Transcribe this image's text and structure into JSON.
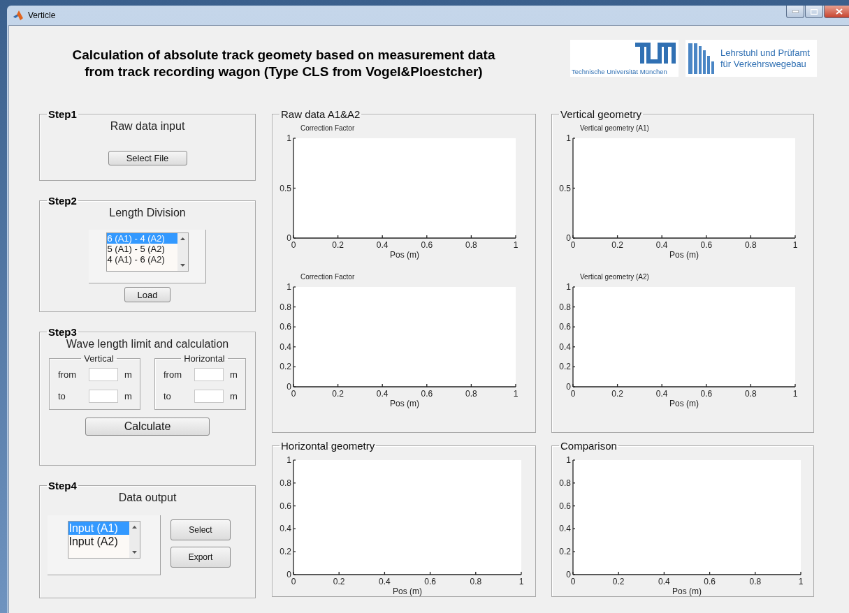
{
  "window": {
    "title": "Verticle"
  },
  "header": {
    "title_lines": [
      "Calculation of absolute track geomety based on measurement data",
      "from track recording wagon (Type CLS from Vogel&Ploestcher)"
    ],
    "logos": [
      {
        "kind": "tum",
        "lines": [
          "Technische Universität München"
        ]
      },
      {
        "kind": "chair",
        "lines": [
          "Lehrstuhl und Prüfamt",
          "für Verkehrswegebau"
        ]
      }
    ]
  },
  "steps": [
    {
      "legend": "Step1",
      "kind": "file",
      "heading": "Raw data input",
      "buttons": [
        "Select File"
      ]
    },
    {
      "legend": "Step2",
      "kind": "list",
      "heading": "Length Division",
      "options": [
        {
          "label": "6 (A1) - 4 (A2)",
          "selected": true
        },
        {
          "label": "5 (A1) - 5 (A2)",
          "selected": false
        },
        {
          "label": "4 (A1) - 6 (A2)",
          "selected": false
        }
      ],
      "buttons": [
        "Load"
      ]
    },
    {
      "legend": "Step3",
      "kind": "range",
      "heading": "Wave length limit and calculation",
      "groups": [
        {
          "title": "Vertical",
          "rows": [
            {
              "label": "from",
              "unit": "m"
            },
            {
              "label": "to",
              "unit": "m"
            }
          ]
        },
        {
          "title": "Horizontal",
          "rows": [
            {
              "label": "from",
              "unit": "m"
            },
            {
              "label": "to",
              "unit": "m"
            }
          ]
        }
      ],
      "buttons": [
        "Calculate"
      ]
    },
    {
      "legend": "Step4",
      "kind": "output",
      "heading": "Data output",
      "options": [
        {
          "label": "Input (A1)",
          "selected": true
        },
        {
          "label": "Input (A2)",
          "selected": false
        }
      ],
      "buttons": [
        "Select",
        "Export"
      ]
    }
  ],
  "plot_panels": [
    {
      "title": "Raw data A1&A2",
      "charts": [
        {
          "chart_data": {
            "type": "line",
            "title": "Correction Factor",
            "xlabel": "Pos (m)",
            "xlim": [
              0,
              1
            ],
            "ylim": [
              0,
              1
            ],
            "xticks": [
              0,
              0.2,
              0.4,
              0.6,
              0.8,
              1
            ],
            "yticks": [
              0,
              0.5,
              1
            ]
          }
        },
        {
          "chart_data": {
            "type": "line",
            "title": "Correction Factor",
            "xlabel": "Pos (m)",
            "xlim": [
              0,
              1
            ],
            "ylim": [
              0,
              1
            ],
            "xticks": [
              0,
              0.2,
              0.4,
              0.6,
              0.8,
              1
            ],
            "yticks": [
              0,
              0.2,
              0.4,
              0.6,
              0.8,
              1
            ]
          }
        }
      ]
    },
    {
      "title": "Vertical geometry",
      "charts": [
        {
          "chart_data": {
            "type": "line",
            "title": "Vertical geometry (A1)",
            "xlabel": "Pos (m)",
            "xlim": [
              0,
              1
            ],
            "ylim": [
              0,
              1
            ],
            "xticks": [
              0,
              0.2,
              0.4,
              0.6,
              0.8,
              1
            ],
            "yticks": [
              0,
              0.5,
              1
            ]
          }
        },
        {
          "chart_data": {
            "type": "line",
            "title": "Vertical geometry (A2)",
            "xlabel": "Pos (m)",
            "xlim": [
              0,
              1
            ],
            "ylim": [
              0,
              1
            ],
            "xticks": [
              0,
              0.2,
              0.4,
              0.6,
              0.8,
              1
            ],
            "yticks": [
              0,
              0.2,
              0.4,
              0.6,
              0.8,
              1
            ]
          }
        }
      ]
    },
    {
      "title": "Horizontal geometry",
      "charts": [
        {
          "chart_data": {
            "type": "line",
            "xlabel": "Pos (m)",
            "xlim": [
              0,
              1
            ],
            "ylim": [
              0,
              1
            ],
            "xticks": [
              0,
              0.2,
              0.4,
              0.6,
              0.8,
              1
            ],
            "yticks": [
              0,
              0.2,
              0.4,
              0.6,
              0.8,
              1
            ]
          }
        }
      ]
    },
    {
      "title": "Comparison",
      "charts": [
        {
          "chart_data": {
            "type": "line",
            "xlabel": "Pos (m)",
            "xlim": [
              0,
              1
            ],
            "ylim": [
              0,
              1
            ],
            "xticks": [
              0,
              0.2,
              0.4,
              0.6,
              0.8,
              1
            ],
            "yticks": [
              0,
              0.2,
              0.4,
              0.6,
              0.8,
              1
            ]
          }
        }
      ]
    }
  ]
}
